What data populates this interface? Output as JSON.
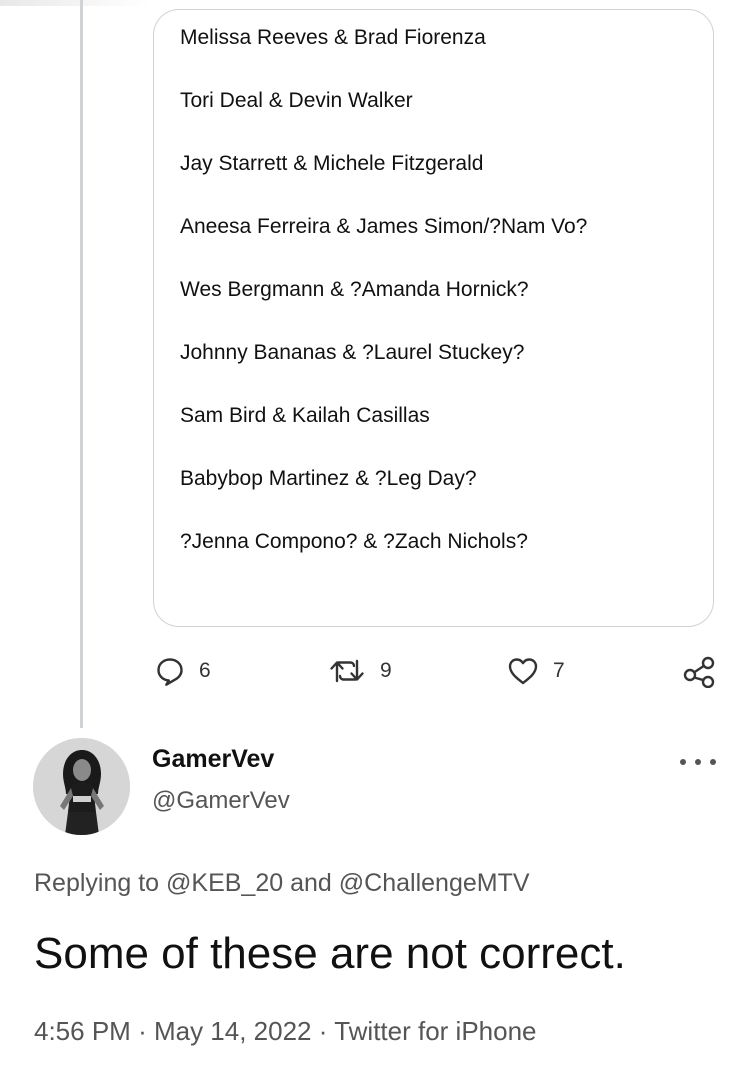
{
  "quote": {
    "lines": [
      "Melissa Reeves & Brad Fiorenza",
      "Tori Deal & Devin Walker",
      "Jay Starrett & Michele Fitzgerald",
      "Aneesa Ferreira & James Simon/?Nam Vo?",
      "Wes Bergmann & ?Amanda Hornick?",
      "Johnny Bananas & ?Laurel Stuckey?",
      "Sam Bird & Kailah Casillas",
      "Babybop Martinez & ?Leg Day?",
      "?Jenna Compono? & ?Zach Nichols?"
    ]
  },
  "actions": {
    "reply_icon": "reply-icon",
    "replies": "6",
    "retweet_icon": "retweet-icon",
    "retweets": "9",
    "like_icon": "heart-icon",
    "likes": "7",
    "share_icon": "share-icon"
  },
  "reply_tweet": {
    "display_name": "GamerVev",
    "handle": "@GamerVev",
    "replying_prefix": "Replying to",
    "replying_user_1": "@KEB_20",
    "replying_and": "and",
    "replying_user_2": "@ChallengeMTV",
    "text": "Some of these are not correct.",
    "time": "4:56 PM",
    "separator_1": "·",
    "date": "May 14, 2022",
    "separator_2": "·",
    "source": "Twitter for iPhone"
  }
}
